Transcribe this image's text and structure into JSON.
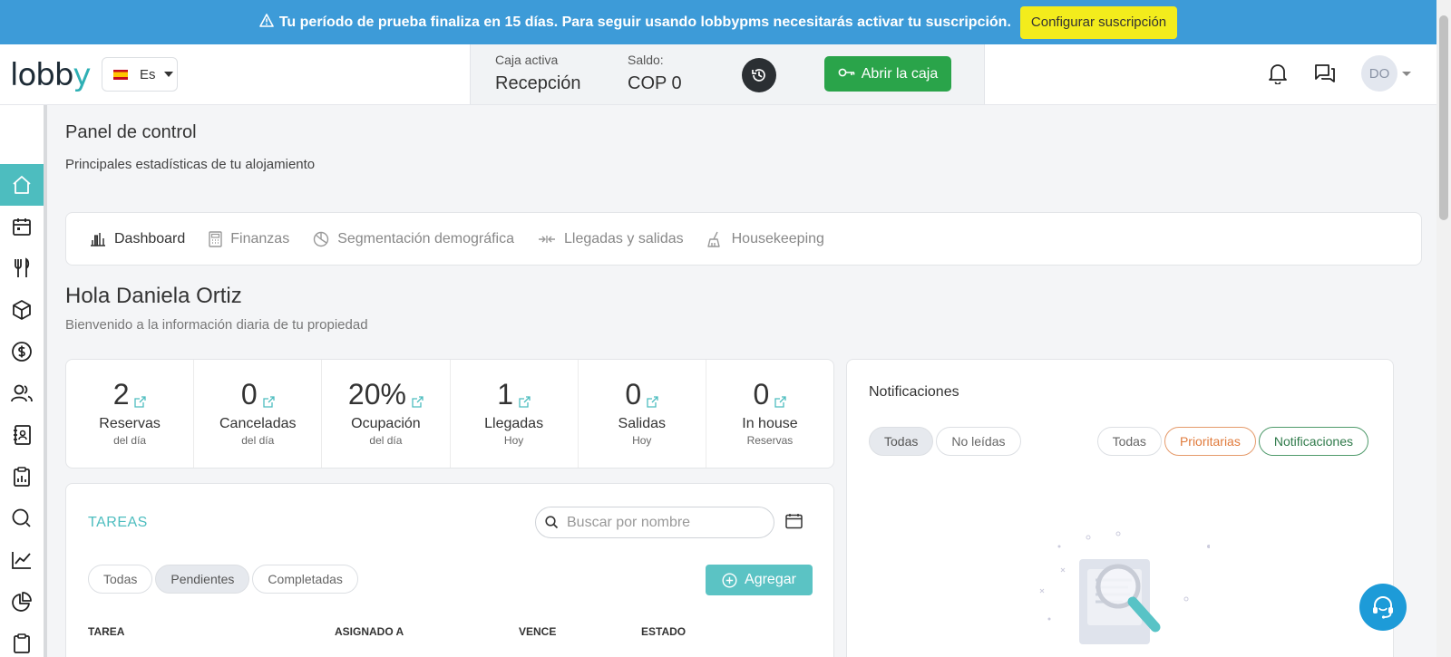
{
  "banner": {
    "icon": "warning-icon",
    "message": "Tu período de prueba finaliza en 15 días. Para seguir usando lobbypms necesitarás activar tu suscripción.",
    "cta_label": "Configurar suscripción",
    "background": "#3d9bd8",
    "cta_color": "#f3ec1c"
  },
  "topbar": {
    "logo": {
      "text_main": "lobb",
      "text_accent": "y"
    },
    "language": {
      "flag": "spain-flag-icon",
      "label": "Es"
    },
    "cash": {
      "active_label": "Caja activa",
      "active_value": "Recepción",
      "balance_label": "Saldo:",
      "balance_value": "COP 0",
      "history_icon": "history-icon",
      "open_button_label": "Abrir la caja",
      "open_button_color": "#2aa44a"
    },
    "user_initials": "DO"
  },
  "sidebar": {
    "accent": "#4dbdbf",
    "items": [
      {
        "icon": "home-icon",
        "active": true
      },
      {
        "icon": "calendar-icon"
      },
      {
        "icon": "restaurant-icon"
      },
      {
        "icon": "box-icon"
      },
      {
        "icon": "dollar-icon"
      },
      {
        "icon": "users-icon"
      },
      {
        "icon": "contacts-icon"
      },
      {
        "icon": "clipboard-report-icon"
      },
      {
        "icon": "search-icon"
      },
      {
        "icon": "line-chart-icon"
      },
      {
        "icon": "pie-chart-icon"
      },
      {
        "icon": "clipboard-icon"
      }
    ]
  },
  "page": {
    "title": "Panel de control",
    "subtitle": "Principales estadísticas de tu alojamiento"
  },
  "tabs": [
    {
      "label": "Dashboard",
      "icon": "bar-chart-icon",
      "active": true
    },
    {
      "label": "Finanzas",
      "icon": "calculator-icon"
    },
    {
      "label": "Segmentación demográfica",
      "icon": "pie-icon"
    },
    {
      "label": "Llegadas y salidas",
      "icon": "arrows-icon"
    },
    {
      "label": "Housekeeping",
      "icon": "broom-icon"
    }
  ],
  "greeting": {
    "title": "Hola Daniela Ortiz",
    "subtitle": "Bienvenido a la información diaria de tu propiedad"
  },
  "stats": [
    {
      "value": "2",
      "label": "Reservas",
      "sub": "del día"
    },
    {
      "value": "0",
      "label": "Canceladas",
      "sub": "del día"
    },
    {
      "value": "20%",
      "label": "Ocupación",
      "sub": "del día"
    },
    {
      "value": "1",
      "label": "Llegadas",
      "sub": "Hoy"
    },
    {
      "value": "0",
      "label": "Salidas",
      "sub": "Hoy"
    },
    {
      "value": "0",
      "label": "In house",
      "sub": "Reservas"
    }
  ],
  "tasks": {
    "title": "TAREAS",
    "search_placeholder": "Buscar por nombre",
    "filters": [
      "Todas",
      "Pendientes",
      "Completadas"
    ],
    "selected_filter": "Pendientes",
    "add_label": "Agregar",
    "columns": [
      "TAREA",
      "ASIGNADO A",
      "VENCE",
      "ESTADO"
    ]
  },
  "notifications": {
    "title": "Notificaciones",
    "read_filters": [
      "Todas",
      "No leídas"
    ],
    "type_filters": [
      "Todas",
      "Prioritarias",
      "Notificaciones"
    ]
  },
  "help_icon": "headset-icon"
}
